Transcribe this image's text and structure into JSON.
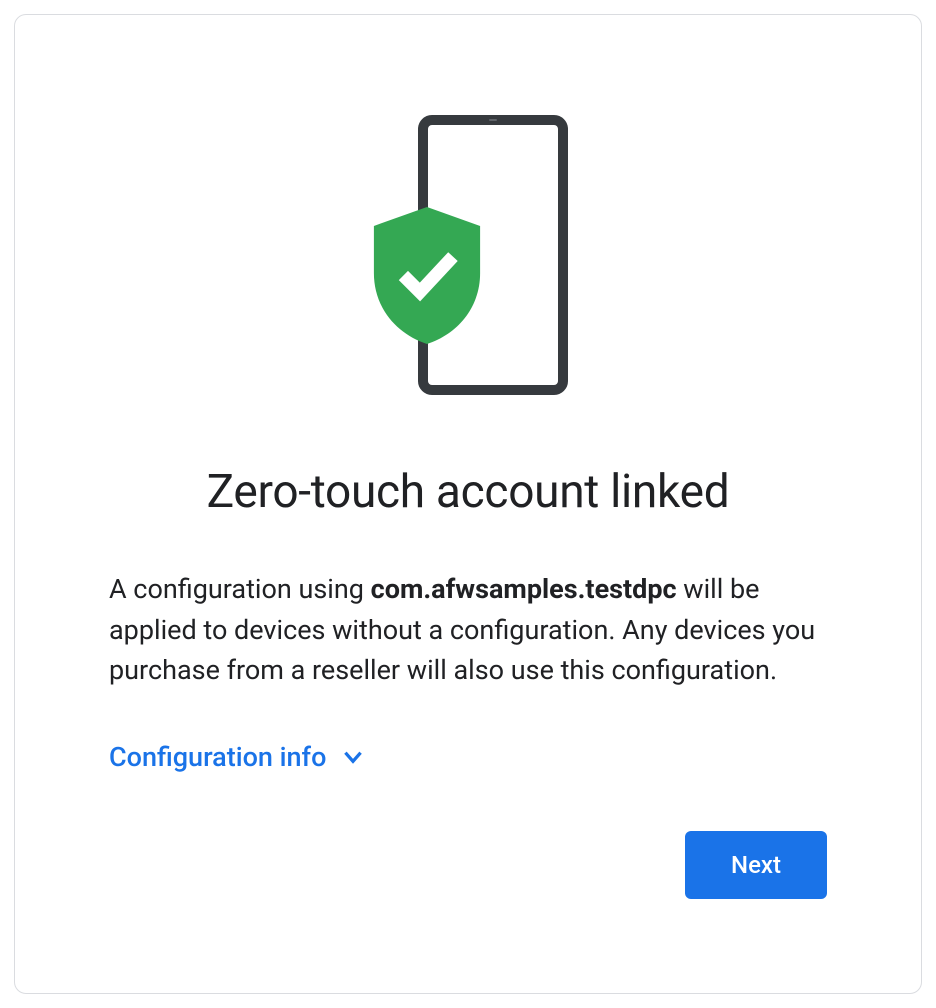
{
  "heading": "Zero-touch account linked",
  "description": {
    "prefix": "A configuration using ",
    "package": "com.afwsamples.testdpc",
    "suffix": " will be applied to devices without a configuration. Any devices you purchase from a reseller will also use this configuration."
  },
  "expander_label": "Configuration info",
  "next_label": "Next",
  "colors": {
    "primary": "#1a73e8",
    "shield": "#34a853",
    "text": "#202124",
    "border": "#dadce0"
  }
}
